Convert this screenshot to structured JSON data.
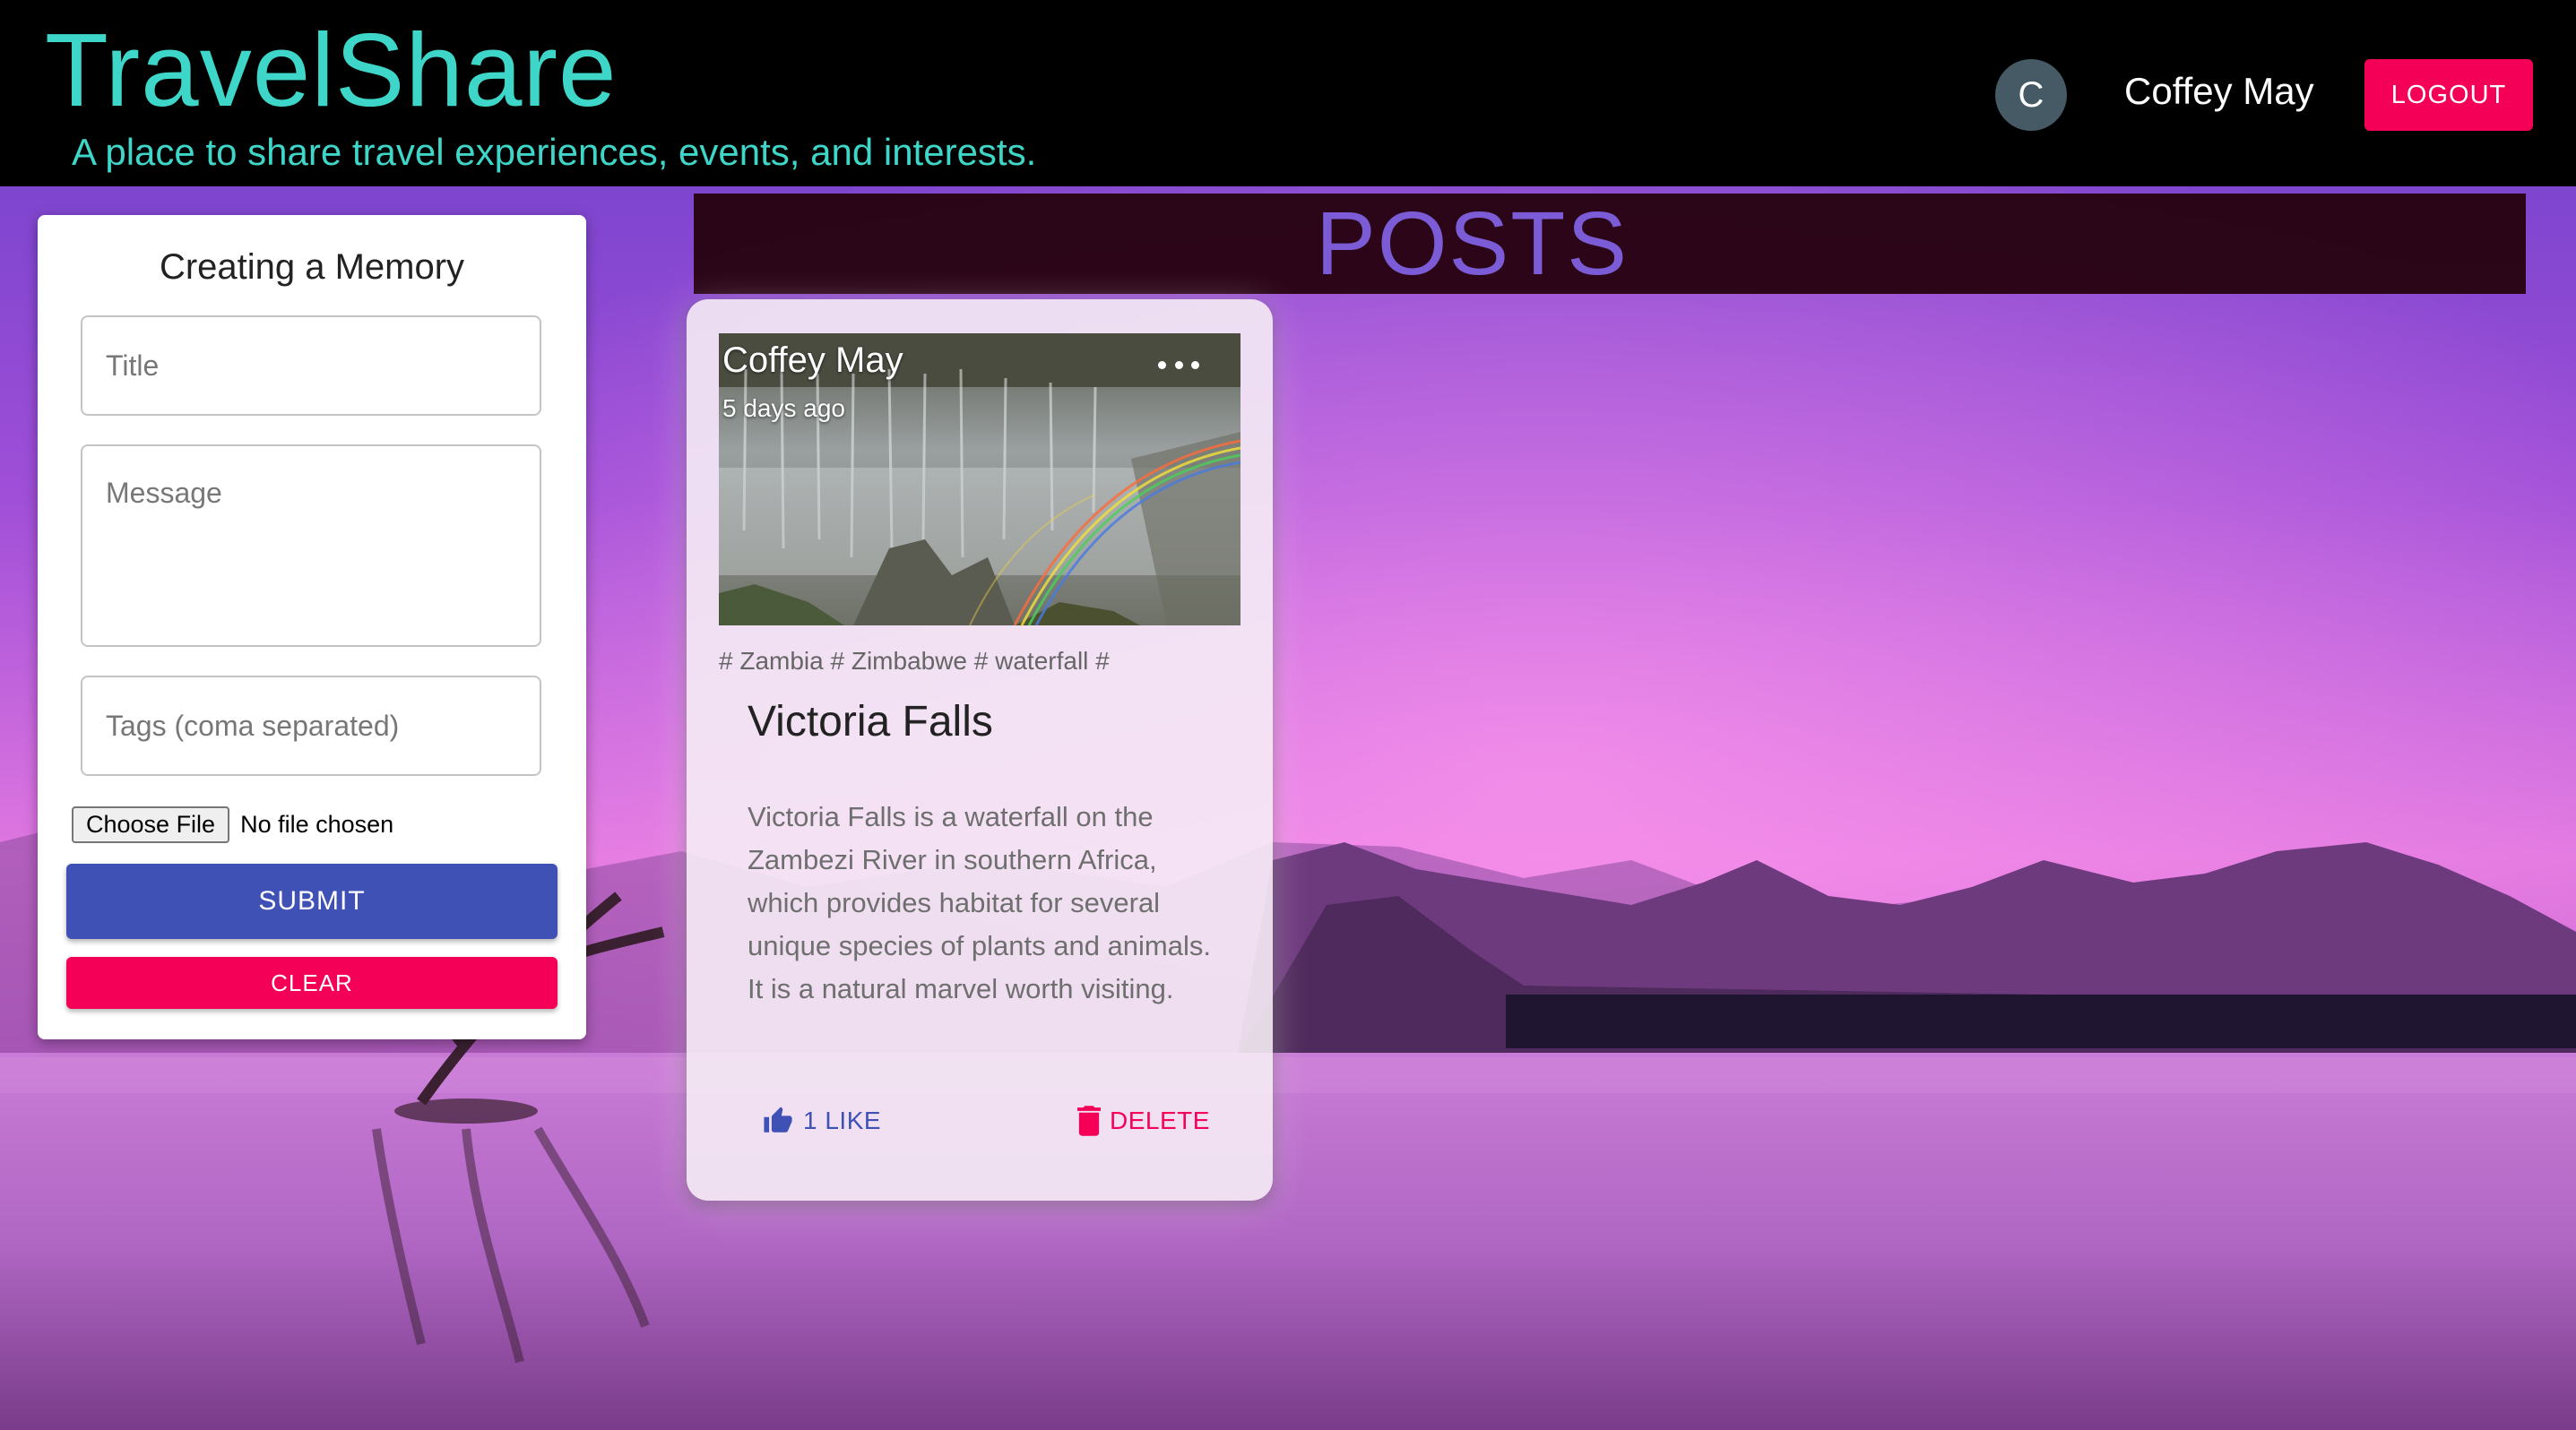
{
  "header": {
    "brand": "TravelShare",
    "tagline": "A place to share travel experiences, events, and interests.",
    "avatar_initial": "C",
    "username": "Coffey May",
    "logout_label": "LOGOUT"
  },
  "form": {
    "title": "Creating a Memory",
    "title_placeholder": "Title",
    "message_placeholder": "Message",
    "tags_placeholder": "Tags (coma separated)",
    "file_button_label": "Choose File",
    "file_status": "No file chosen",
    "submit_label": "SUBMIT",
    "clear_label": "CLEAR"
  },
  "posts": {
    "heading": "POSTS",
    "items": [
      {
        "author": "Coffey May",
        "time": "5 days ago",
        "tags": "# Zambia # Zimbabwe # waterfall #",
        "title": "Victoria Falls",
        "message": "Victoria Falls is a waterfall on the Zambezi River in southern Africa, which provides habitat for several unique species of plants and animals. It is a natural marvel worth visiting.",
        "like_label": "1 LIKE",
        "delete_label": "DELETE"
      }
    ]
  },
  "colors": {
    "brand": "#3ed6c8",
    "header_bg": "#000000",
    "primary": "#3f51b5",
    "secondary": "#f50057",
    "avatar": "#455a64",
    "posts_heading": "#7b5cd6"
  },
  "icons": {
    "more": "more-horizontal-icon",
    "like": "thumb-up-icon",
    "delete": "trash-icon"
  }
}
